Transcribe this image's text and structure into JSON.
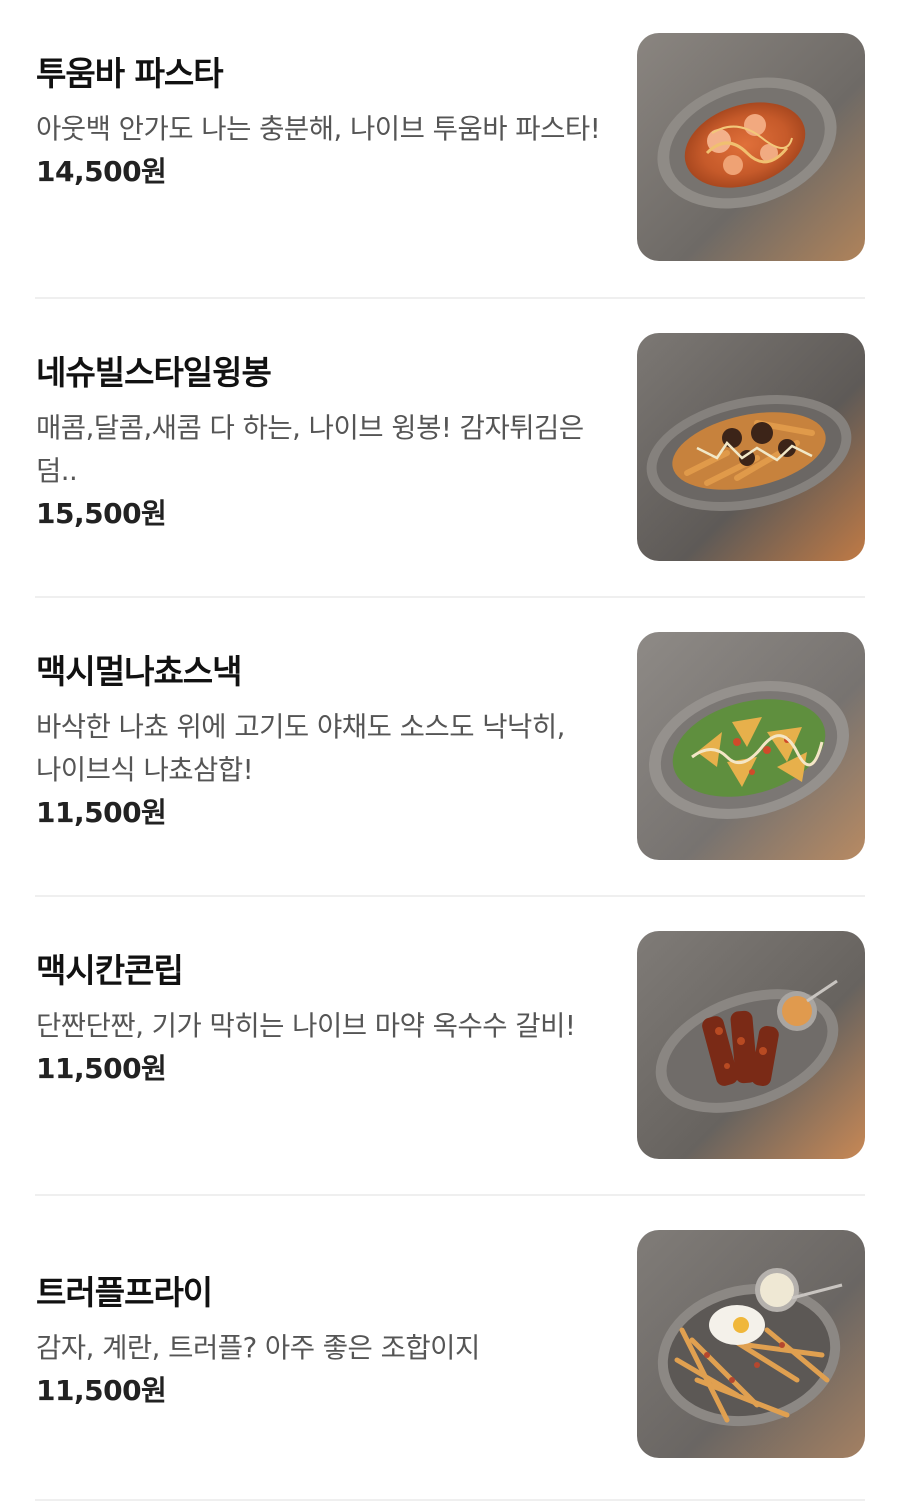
{
  "menu": {
    "items": [
      {
        "name": "투움바 파스타",
        "description": "아웃백 안가도 나는 충분해, 나이브 투움바 파스타!",
        "price": "14,500원",
        "photo_icon": "pasta-dish-photo"
      },
      {
        "name": "네슈빌스타일윙봉",
        "description": "매콤,달콤,새콤 다 하는, 나이브 윙봉! 감자튀김은 덤..",
        "price": "15,500원",
        "photo_icon": "wings-dish-photo"
      },
      {
        "name": "맥시멀나쵸스낵",
        "description": "바삭한 나쵸 위에 고기도 야채도 소스도 낙낙히, 나이브식 나쵸삼합!",
        "price": "11,500원",
        "photo_icon": "nachos-dish-photo"
      },
      {
        "name": "맥시칸콘립",
        "description": "단짠단짠, 기가 막히는 나이브 마약 옥수수 갈비!",
        "price": "11,500원",
        "photo_icon": "corn-ribs-dish-photo"
      },
      {
        "name": "트러플프라이",
        "description": "감자, 계란, 트러플? 아주 좋은 조합이지",
        "price": "11,500원",
        "photo_icon": "truffle-fries-dish-photo"
      }
    ]
  },
  "colors": {
    "name": "#111111",
    "description": "#555555",
    "price": "#222222",
    "divider": "#efefef"
  }
}
